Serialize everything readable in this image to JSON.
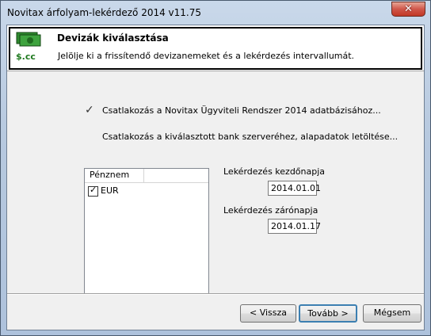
{
  "window": {
    "title": "Novitax árfolyam-lekérdező 2014 v11.75",
    "close_glyph": "✕"
  },
  "header": {
    "title": "Devizák kiválasztása",
    "subtitle": "Jelölje ki a frissítendő devizanemeket és a lekérdezés intervallumát.",
    "icon": "money-icon",
    "icon_text": "$.cc"
  },
  "steps": [
    {
      "label": "Csatlakozás a Novitax Ügyviteli Rendszer 2014 adatbázisához...",
      "checked": true,
      "check_glyph": "✓"
    },
    {
      "label": "Csatlakozás a kiválasztott bank szerveréhez, alapadatok letöltése...",
      "checked": false
    }
  ],
  "currency_list": {
    "column_header": "Pénznem",
    "items": [
      {
        "label": "EUR",
        "checked": true,
        "tick": "✓"
      }
    ]
  },
  "query": {
    "start_label": "Lekérdezés kezdőnapja",
    "start_value": "2014.01.01",
    "end_label": "Lekérdezés zárónapja",
    "end_value": "2014.01.17"
  },
  "buttons": {
    "back": "< Vissza",
    "next": "Tovább >",
    "cancel": "Mégsem"
  },
  "colors": {
    "title_bar": "#b7c9df",
    "close": "#c23826",
    "default_border": "#3c7fb1",
    "icon_green": "#2f8a2f"
  }
}
